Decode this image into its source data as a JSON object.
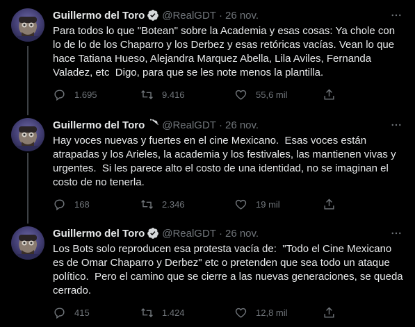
{
  "tweets": [
    {
      "author_name": "Guillermo del Toro",
      "handle": "@RealGDT",
      "separator": "·",
      "date": "26 nov.",
      "text": "Para todos lo que \"Botean\" sobre la Academia y esas cosas: Ya chole con lo de lo de los Chaparro y los Derbez y esas retóricas vacías. Vean lo que hace Tatiana Hueso, Alejandra Marquez Abella, Lila Aviles, Fernanda Valadez, etc  Digo, para que se les note menos la plantilla.",
      "replies": "1.695",
      "retweets": "9.416",
      "likes": "55,6 mil"
    },
    {
      "author_name": "Guillermo del Toro",
      "handle": "@RealGDT",
      "separator": "·",
      "date": "26 nov.",
      "text": "Hay voces nuevas y fuertes en el cine Mexicano.  Esas voces están atrapadas y los Arieles, la academia y los festivales, las mantienen vivas y urgentes.  Si les parece alto el costo de una identidad, no se imaginan el costo de no tenerla.",
      "replies": "168",
      "retweets": "2.346",
      "likes": "19 mil"
    },
    {
      "author_name": "Guillermo del Toro",
      "handle": "@RealGDT",
      "separator": "·",
      "date": "26 nov.",
      "text": "Los Bots solo reproducen esa protesta vacía de:  \"Todo el Cine Mexicano es de Omar Chaparro y Derbez\" etc o pretenden que sea todo un ataque político.  Pero el camino que se cierre a las nuevas generaciones, se queda cerrado.",
      "replies": "415",
      "retweets": "1.424",
      "likes": "12,8 mil"
    }
  ],
  "icons": {
    "verified": "verified-badge-icon",
    "more": "more-dots-icon",
    "reply": "reply-bubble-icon",
    "retweet": "retweet-arrows-icon",
    "like": "heart-icon",
    "share": "share-upload-icon"
  },
  "colors": {
    "background": "#000000",
    "text": "#e7e9ea",
    "muted": "#71767b",
    "thread_line": "#3d4145",
    "verified": "#d6d9db"
  }
}
